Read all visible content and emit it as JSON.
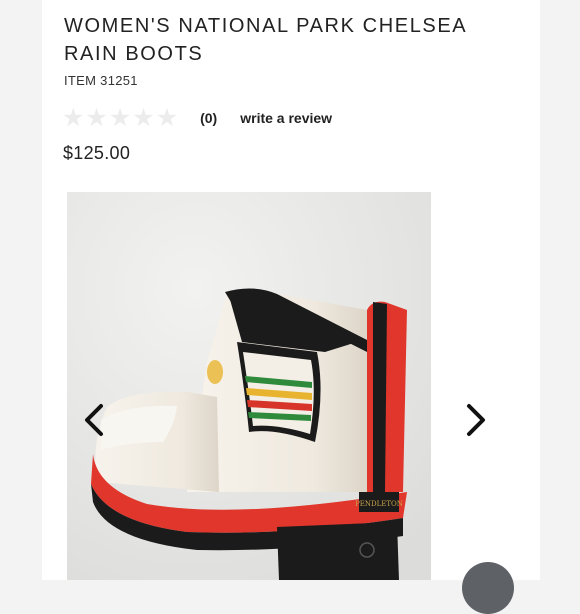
{
  "product": {
    "title": "WOMEN'S NATIONAL PARK CHELSEA RAIN BOOTS",
    "item_number": "ITEM 31251",
    "rating": {
      "stars_filled": 0,
      "stars_total": 5,
      "review_count": "(0)",
      "write_review_label": "write a review"
    },
    "price": "$125.00"
  },
  "image": {
    "brand_mark": "PENDLETON",
    "alt": "white rain boot with red sole and striped gore"
  },
  "carousel": {
    "prev_icon": "chevron-left-icon",
    "next_icon": "chevron-right-icon"
  },
  "colors": {
    "boot_white": "#f1ece4",
    "sole_red": "#e0362c",
    "sole_black": "#1b1b1b",
    "stripe_green": "#2f8a3c",
    "stripe_yellow": "#e8b430",
    "stripe_red": "#d8352a"
  }
}
